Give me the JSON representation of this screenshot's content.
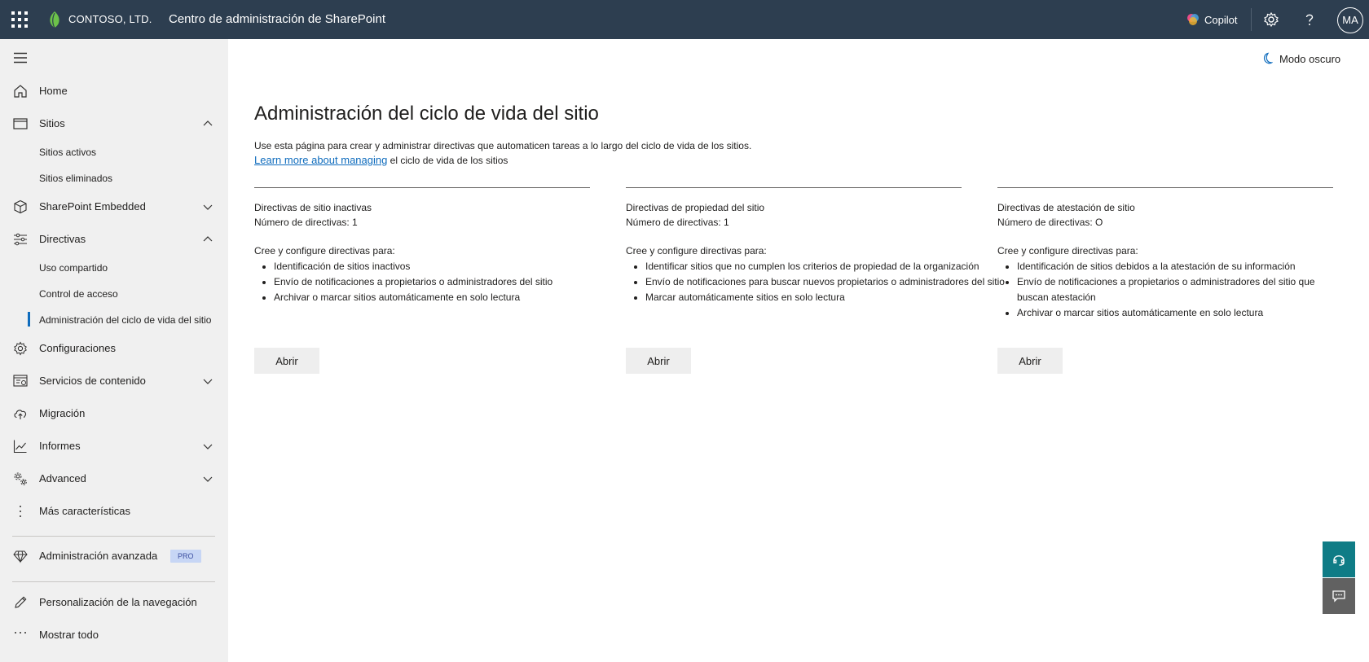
{
  "topbar": {
    "org_name": "CONTOSO, LTD.",
    "app_title": "Centro de administración de SharePoint",
    "copilot_label": "Copilot",
    "avatar_initials": "MA"
  },
  "sidebar": {
    "items": [
      {
        "label": "Home",
        "icon": "home-icon"
      },
      {
        "label": "Sitios",
        "icon": "browser-icon"
      },
      {
        "label": "Sitios activos"
      },
      {
        "label": "Sitios eliminados"
      },
      {
        "label": "SharePoint Embedded",
        "icon": "cube-icon"
      },
      {
        "label": "Directivas",
        "icon": "sliders-icon"
      },
      {
        "label": "Uso compartido"
      },
      {
        "label": "Control de acceso"
      },
      {
        "label": "Administración del ciclo de vida del sitio"
      },
      {
        "label": "Configuraciones",
        "icon": "gear-icon"
      },
      {
        "label": "Servicios de contenido",
        "icon": "content-services-icon"
      },
      {
        "label": "Migración",
        "icon": "cloud-upload-icon"
      },
      {
        "label": "Informes",
        "icon": "line-chart-icon"
      },
      {
        "label": "Advanced",
        "icon": "gears-icon"
      },
      {
        "label": "Más características",
        "icon": "more-vertical-icon"
      },
      {
        "label": "Administración avanzada",
        "icon": "diamond-icon",
        "badge": "PRO"
      },
      {
        "label": "Personalización de la navegación",
        "icon": "pencil-icon"
      },
      {
        "label": "Mostrar todo",
        "icon": "more-horizontal-icon"
      }
    ]
  },
  "main": {
    "dark_mode_label": "Modo oscuro",
    "title": "Administración del ciclo de vida del sitio",
    "description": "Use esta página para crear y administrar directivas que automaticen tareas a lo largo del ciclo de vida de los sitios.",
    "learn_link": "Learn more about managing",
    "learn_rest": " el ciclo de vida de los sitios",
    "cards": [
      {
        "title": "Directivas de sitio inactivas",
        "count": "Número de directivas: 1",
        "intro": "Cree y configure directivas para:",
        "bullets": [
          "Identificación de sitios inactivos",
          "Envío de notificaciones a propietarios o administradores del sitio",
          "Archivar o marcar sitios automáticamente en solo lectura"
        ],
        "button": "Abrir"
      },
      {
        "title": "Directivas de propiedad del sitio",
        "count": "Número de directivas: 1",
        "intro": "Cree y configure directivas para:",
        "bullets": [
          "Identificar sitios que no cumplen los criterios de propiedad de la organización",
          "Envío de notificaciones para buscar nuevos propietarios o administradores del sitio",
          "Marcar automáticamente sitios en solo lectura"
        ],
        "button": "Abrir"
      },
      {
        "title": "Directivas de atestación de sitio",
        "count": "Número de directivas: O",
        "intro": "Cree y configure directivas para:",
        "bullets": [
          "Identificación de sitios debidos a la atestación de su información",
          "Envío de notificaciones a propietarios o administradores del sitio que buscan atestación",
          "Archivar o marcar sitios automáticamente en solo lectura"
        ],
        "button": "Abrir"
      }
    ]
  },
  "colors": {
    "topbar": "#2d3e50",
    "sidebar": "#f0f0f0",
    "accent": "#0f6cbd",
    "help_fab": "#0f7c86"
  }
}
